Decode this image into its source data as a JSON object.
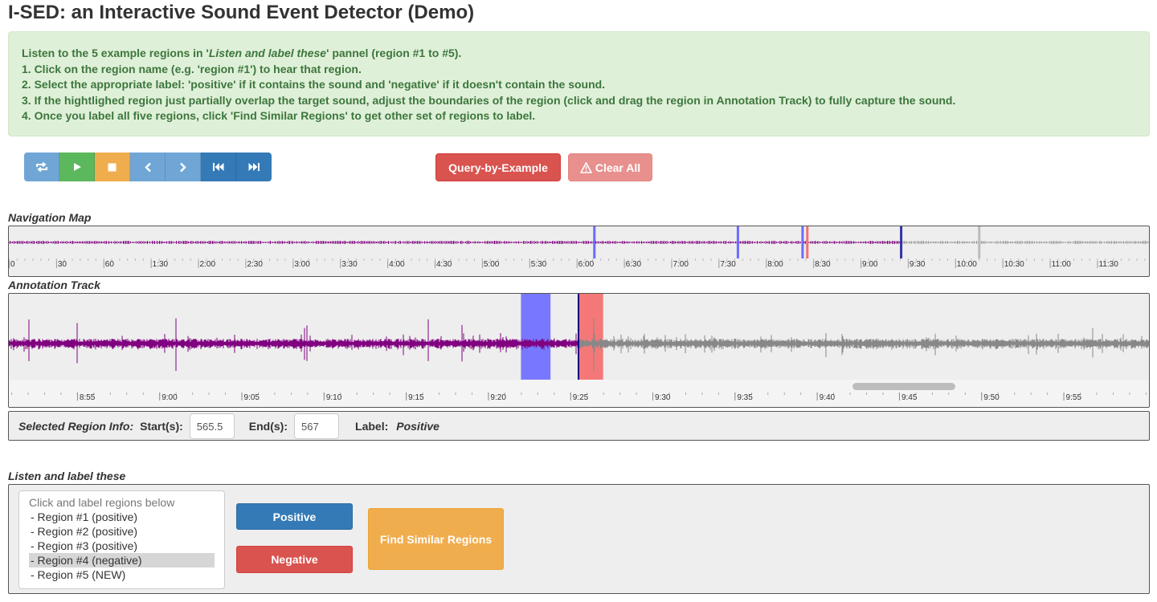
{
  "app": {
    "title": "I-SED: an Interactive Sound Event Detector (Demo)"
  },
  "instructions": {
    "line1_pre": "Listen to the 5 example regions in '",
    "line1_em": "Listen and label these",
    "line1_post": "' pannel (region #1 to #5).",
    "line2": "1. Click on the region name (e.g. 'region #1') to hear that region.",
    "line3": "2. Select the appropriate label: 'positive' if it contains the sound and 'negative' if it doesn't contain the sound.",
    "line4": "3. If the hightlighed region just partially overlap the target sound, adjust the boundaries of the region (click and drag the region in Annotation Track) to fully capture the sound.",
    "line5": "4. Once you label all five regions, click 'Find Similar Regions' to get other set of regions to label."
  },
  "toolbar": {
    "buttons": [
      {
        "icon": "repeat-icon",
        "color": "#6fa6d6"
      },
      {
        "icon": "play-icon",
        "color": "#5cb85c"
      },
      {
        "icon": "stop-icon",
        "color": "#f0ad4e"
      },
      {
        "icon": "chevron-left-icon",
        "color": "#6fa6d6"
      },
      {
        "icon": "chevron-right-icon",
        "color": "#6fa6d6"
      },
      {
        "icon": "fast-backward-icon",
        "color": "#337ab7"
      },
      {
        "icon": "fast-forward-icon",
        "color": "#337ab7"
      }
    ],
    "query_label": "Query-by-Example",
    "clear_label": "Clear All",
    "clear_icon": "warning-icon"
  },
  "navigation": {
    "label": "Navigation Map",
    "tick_labels": [
      "0",
      "30",
      "60",
      "1:30",
      "2:00",
      "2:30",
      "3:00",
      "3:30",
      "4:00",
      "4:30",
      "5:00",
      "5:30",
      "6:00",
      "6:30",
      "7:00",
      "7:30",
      "8:00",
      "8:30",
      "9:00",
      "9:30",
      "10:00",
      "10:30",
      "11:00",
      "11:30"
    ],
    "tick_seconds": [
      0,
      30,
      60,
      90,
      120,
      150,
      180,
      210,
      240,
      270,
      300,
      330,
      360,
      390,
      420,
      450,
      480,
      510,
      540,
      570,
      600,
      630,
      660,
      690
    ],
    "markers_seconds": [
      {
        "t": 371,
        "color": "#6b6bff"
      },
      {
        "t": 462,
        "color": "#6b6bff"
      },
      {
        "t": 503,
        "color": "#6b6bff"
      },
      {
        "t": 506,
        "color": "#f07070"
      },
      {
        "t": 565.5,
        "color": "#3333aa"
      },
      {
        "t": 615,
        "color": "#bbbbbb"
      }
    ],
    "played_until_seconds": 565.5,
    "waveform_color": "#800080",
    "unplayed_color": "#999999"
  },
  "annotation": {
    "label": "Annotation Track",
    "tick_labels": [
      "8:55",
      "9:00",
      "9:05",
      "9:10",
      "9:15",
      "9:20",
      "9:25",
      "9:30",
      "9:35",
      "9:40",
      "9:45",
      "9:50",
      "9:55"
    ],
    "tick_seconds": [
      535,
      540,
      545,
      550,
      555,
      560,
      565,
      570,
      575,
      580,
      585,
      590,
      595
    ],
    "view_start_seconds": 530.85,
    "view_end_seconds": 600.3,
    "regions": [
      {
        "start": 562,
        "end": 563.8,
        "color": "#7878ff",
        "name": "blue-region"
      },
      {
        "start": 565.5,
        "end": 567,
        "color": "#f57878",
        "name": "red-region"
      }
    ],
    "cursor_seconds": 565.5,
    "played_color": "#800080",
    "unplayed_color": "#888888"
  },
  "region_info": {
    "title": "Selected Region Info:",
    "start_label": "Start(s):",
    "start_value": "565.5",
    "end_label": "End(s):",
    "end_value": "567",
    "label_label": "Label:",
    "label_value": "Positive"
  },
  "listen": {
    "label": "Listen and label these",
    "list_header": "Click and label regions below",
    "items": [
      "- Region #1 (positive)",
      "- Region #2 (positive)",
      "- Region #3 (positive)",
      "- Region #4 (negative)",
      "- Region #5 (NEW)"
    ],
    "selected_index": 3,
    "positive_label": "Positive",
    "negative_label": "Negative",
    "find_label": "Find Similar Regions"
  }
}
